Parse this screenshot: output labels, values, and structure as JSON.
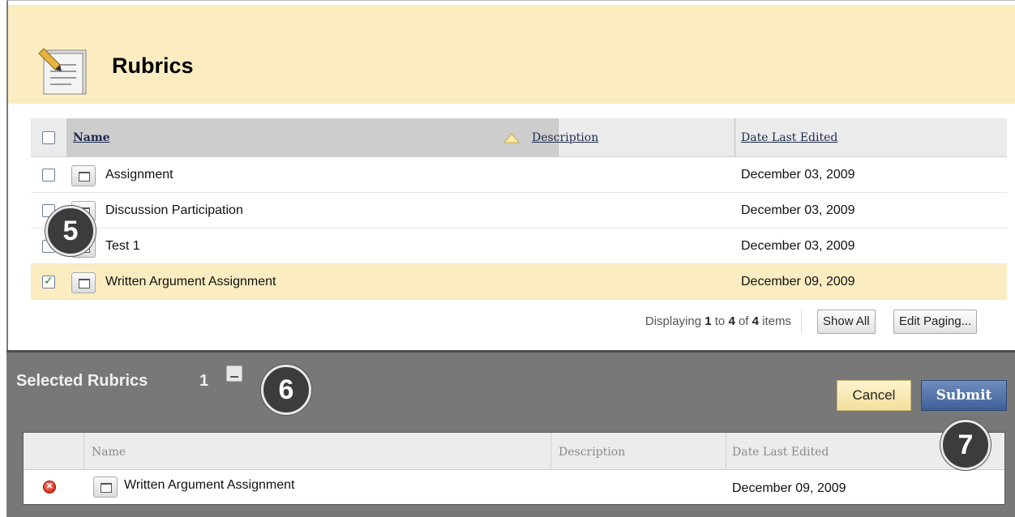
{
  "header": {
    "title": "Rubrics",
    "icon": "rubric-document-icon"
  },
  "table": {
    "columns": {
      "name": "Name",
      "description": "Description",
      "date": "Date Last Edited"
    },
    "sort": "ascending",
    "rows": [
      {
        "name": "Assignment",
        "description": "",
        "date": "December 03, 2009",
        "checked": false
      },
      {
        "name": "Discussion Participation",
        "description": "",
        "date": "December 03, 2009",
        "checked": false
      },
      {
        "name": "Test 1",
        "description": "",
        "date": "December 03, 2009",
        "checked": false
      },
      {
        "name": "Written Argument Assignment",
        "description": "",
        "date": "December 09, 2009",
        "checked": true
      }
    ]
  },
  "paging": {
    "prefix": "Displaying",
    "from": "1",
    "to_word": "to",
    "to": "4",
    "of_word": "of",
    "total": "4",
    "suffix": "items",
    "show_all": "Show All",
    "edit_paging": "Edit Paging..."
  },
  "selected": {
    "title": "Selected Rubrics",
    "count": "1",
    "cancel": "Cancel",
    "submit": "Submit",
    "columns": {
      "name": "Name",
      "description": "Description",
      "date": "Date Last Edited"
    },
    "rows": [
      {
        "name": "Written Argument Assignment",
        "description": "",
        "date": "December 09, 2009"
      }
    ]
  },
  "callouts": [
    "5",
    "6",
    "7"
  ],
  "colors": {
    "header_bg": "#fbedc1",
    "panel_bg": "#787878",
    "submit_bg": "#3f5f97",
    "cancel_bg": "#f4df9b"
  }
}
